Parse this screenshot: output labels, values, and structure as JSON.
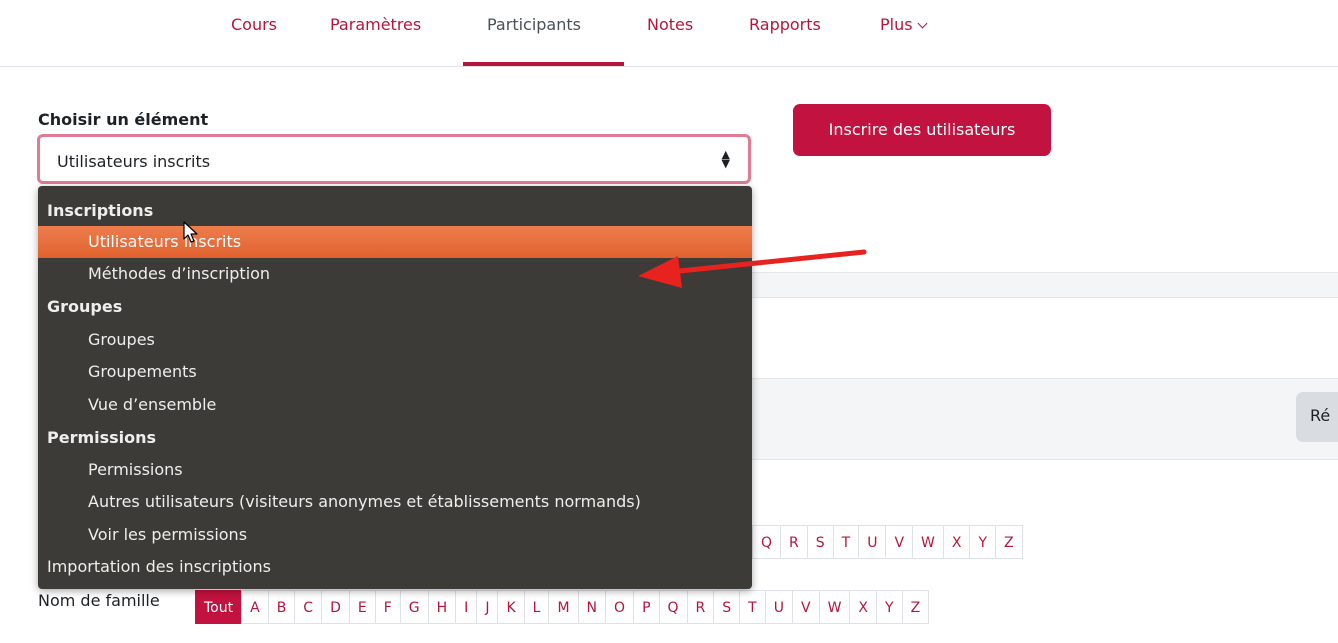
{
  "nav": {
    "items": [
      "Cours",
      "Paramètres",
      "Participants",
      "Notes",
      "Rapports",
      "Plus"
    ],
    "active": "Participants"
  },
  "selector": {
    "label": "Choisir un élément",
    "value": "Utilisateurs inscrits"
  },
  "enrol_button": "Inscrire des utilisateurs",
  "background": {
    "reset_button_partial": "Ré"
  },
  "dropdown": {
    "groups": [
      {
        "label": "Inscriptions",
        "options": [
          "Utilisateurs inscrits",
          "Méthodes d’inscription"
        ]
      },
      {
        "label": "Groupes",
        "options": [
          "Groupes",
          "Groupements",
          "Vue d’ensemble"
        ]
      },
      {
        "label": "Permissions",
        "options": [
          "Permissions",
          "Autres utilisateurs (visiteurs anonymes et établissements normands)",
          "Voir les permissions"
        ]
      }
    ],
    "standalone": "Importation des inscriptions",
    "selected": "Utilisateurs inscrits"
  },
  "firstname_letters_visible": [
    "Q",
    "R",
    "S",
    "T",
    "U",
    "V",
    "W",
    "X",
    "Y",
    "Z"
  ],
  "lastname": {
    "label": "Nom de famille",
    "letters": [
      "Tout",
      "A",
      "B",
      "C",
      "D",
      "E",
      "F",
      "G",
      "H",
      "I",
      "J",
      "K",
      "L",
      "M",
      "N",
      "O",
      "P",
      "Q",
      "R",
      "S",
      "T",
      "U",
      "V",
      "W",
      "X",
      "Y",
      "Z"
    ],
    "active": "Tout"
  },
  "colors": {
    "brand": "#c2123f",
    "dropdown_bg": "#3c3b37",
    "highlight": "#e96f3f",
    "annotation_arrow": "#e8231f"
  }
}
